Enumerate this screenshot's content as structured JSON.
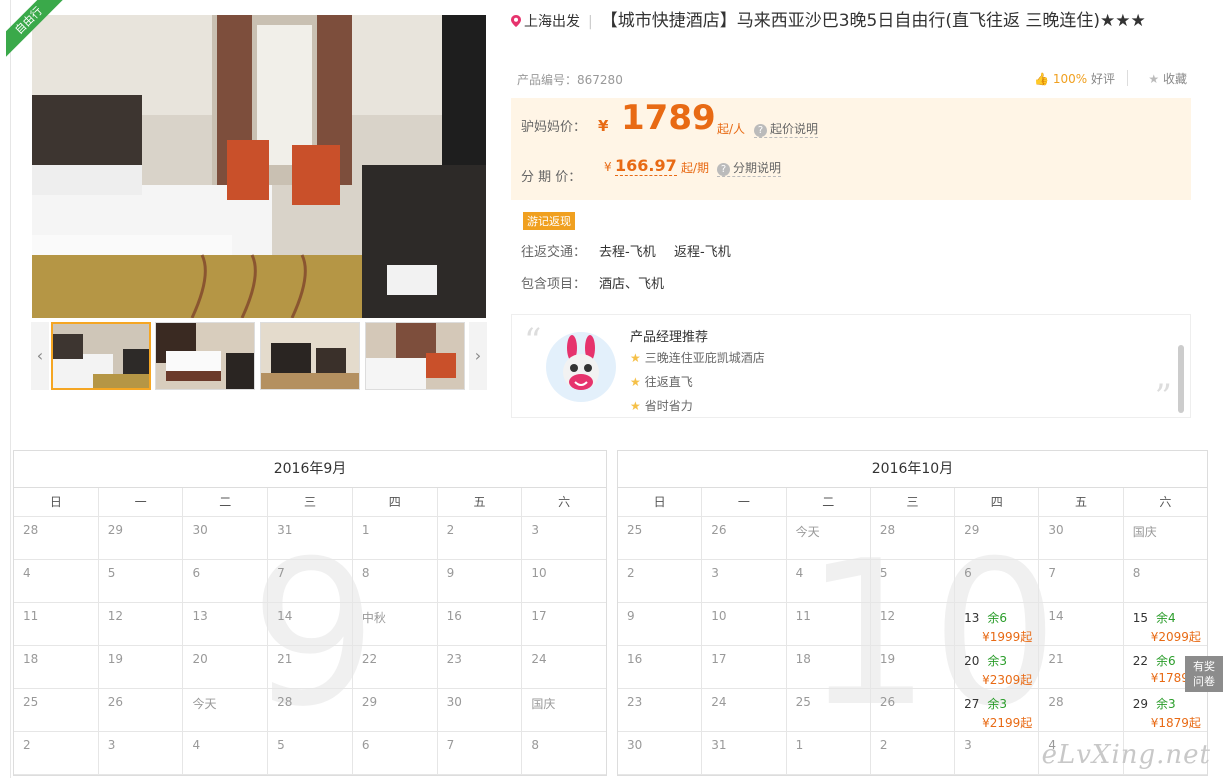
{
  "ribbon": "自由行",
  "product": {
    "depart_city": "上海出发",
    "title": "【城市快捷酒店】马来西亚沙巴3晚5日自由行(直飞往返 三晚连住)★★★",
    "product_no_label": "产品编号：",
    "product_no": "867280",
    "rating_pct": "100%",
    "rating_label": "好评",
    "favorite_label": "收藏"
  },
  "price": {
    "label": "驴妈妈价：",
    "currency": "¥",
    "amount": "1789",
    "unit": "起/人",
    "note": "起价说明",
    "installment_label": "分 期 价：",
    "installment_amount": "166.97",
    "installment_unit": "起/期",
    "installment_note": "分期说明"
  },
  "tag": "游记返现",
  "transport": {
    "label": "往返交通：",
    "outbound": "去程-飞机",
    "return": "返程-飞机"
  },
  "includes": {
    "label": "包含项目：",
    "value": "酒店、飞机"
  },
  "recommend": {
    "title": "产品经理推荐",
    "items": [
      "三晚连住亚庇凯城酒店",
      "往返直飞",
      "省时省力"
    ]
  },
  "weekdays": [
    "日",
    "一",
    "二",
    "三",
    "四",
    "五",
    "六"
  ],
  "calendars": [
    {
      "title": "2016年9月",
      "bg_digit": "9",
      "rows": [
        [
          {
            "d": "28"
          },
          {
            "d": "29"
          },
          {
            "d": "30"
          },
          {
            "d": "31"
          },
          {
            "d": "1"
          },
          {
            "d": "2"
          },
          {
            "d": "3"
          }
        ],
        [
          {
            "d": "4"
          },
          {
            "d": "5"
          },
          {
            "d": "6"
          },
          {
            "d": "7"
          },
          {
            "d": "8"
          },
          {
            "d": "9"
          },
          {
            "d": "10"
          }
        ],
        [
          {
            "d": "11"
          },
          {
            "d": "12"
          },
          {
            "d": "13"
          },
          {
            "d": "14"
          },
          {
            "d": "中秋"
          },
          {
            "d": "16"
          },
          {
            "d": "17"
          }
        ],
        [
          {
            "d": "18"
          },
          {
            "d": "19"
          },
          {
            "d": "20"
          },
          {
            "d": "21"
          },
          {
            "d": "22"
          },
          {
            "d": "23"
          },
          {
            "d": "24"
          }
        ],
        [
          {
            "d": "25"
          },
          {
            "d": "26"
          },
          {
            "d": "今天"
          },
          {
            "d": "28"
          },
          {
            "d": "29"
          },
          {
            "d": "30"
          },
          {
            "d": "国庆"
          }
        ],
        [
          {
            "d": "2"
          },
          {
            "d": "3"
          },
          {
            "d": "4"
          },
          {
            "d": "5"
          },
          {
            "d": "6"
          },
          {
            "d": "7"
          },
          {
            "d": "8"
          }
        ]
      ]
    },
    {
      "title": "2016年10月",
      "bg_digit": "10",
      "rows": [
        [
          {
            "d": "25"
          },
          {
            "d": "26"
          },
          {
            "d": "今天"
          },
          {
            "d": "28"
          },
          {
            "d": "29"
          },
          {
            "d": "30"
          },
          {
            "d": "国庆"
          }
        ],
        [
          {
            "d": "2"
          },
          {
            "d": "3"
          },
          {
            "d": "4"
          },
          {
            "d": "5"
          },
          {
            "d": "6"
          },
          {
            "d": "7"
          },
          {
            "d": "8"
          }
        ],
        [
          {
            "d": "9"
          },
          {
            "d": "10"
          },
          {
            "d": "11"
          },
          {
            "d": "12"
          },
          {
            "d": "13",
            "stock": "余6",
            "price": "¥1999起"
          },
          {
            "d": "14"
          },
          {
            "d": "15",
            "stock": "余4",
            "price": "¥2099起"
          }
        ],
        [
          {
            "d": "16"
          },
          {
            "d": "17"
          },
          {
            "d": "18"
          },
          {
            "d": "19"
          },
          {
            "d": "20",
            "stock": "余3",
            "price": "¥2309起"
          },
          {
            "d": "21"
          },
          {
            "d": "22",
            "stock": "余6",
            "price": "¥1789"
          }
        ],
        [
          {
            "d": "23"
          },
          {
            "d": "24"
          },
          {
            "d": "25"
          },
          {
            "d": "26"
          },
          {
            "d": "27",
            "stock": "余3",
            "price": "¥2199起"
          },
          {
            "d": "28"
          },
          {
            "d": "29",
            "stock": "余3",
            "price": "¥1879起"
          }
        ],
        [
          {
            "d": "30"
          },
          {
            "d": "31"
          },
          {
            "d": "1"
          },
          {
            "d": "2"
          },
          {
            "d": "3"
          },
          {
            "d": "4"
          },
          {
            "d": ""
          }
        ]
      ]
    }
  ],
  "survey": [
    "有奖",
    "问卷"
  ],
  "watermark": "eLvXing.net"
}
